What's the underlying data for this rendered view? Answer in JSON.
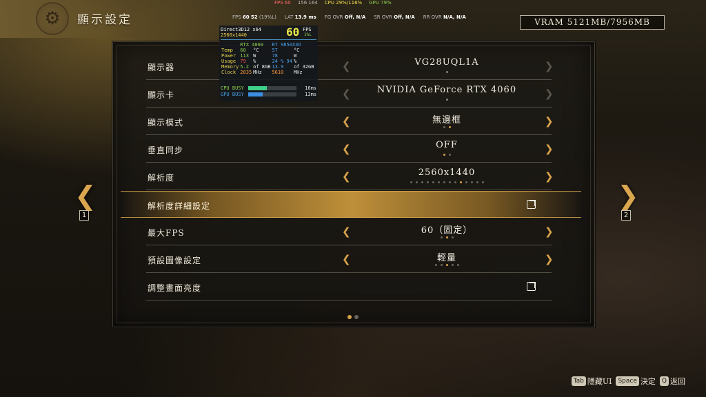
{
  "header": {
    "title": "顯示設定",
    "vram": "VRAM 5121MB/7956MB"
  },
  "top_strip": {
    "fps": "FPS 60",
    "fps_range": "156 164",
    "cpu": "CPU 29%/116%",
    "gpu": "GPU 79%"
  },
  "stats": {
    "fps_label": "FPS",
    "fps_value": "60",
    "fps_low": "52",
    "fps_low_pct": "(19%L)",
    "lat_label": "LAT",
    "lat_value": "13.9 ms",
    "fg_label": "FG OVR",
    "fg_value": "Off,  N/A",
    "sr_label": "SR OVR",
    "sr_value": "Off,  N/A",
    "rr_label": "RR OVR",
    "rr_value": "N/A,  N/A"
  },
  "osd": {
    "api": "Direct3D12 x64",
    "resolution": "2560x1440",
    "fps": "60",
    "fps_label": "FPS",
    "fps_sub": "1%L",
    "gpu_name": "RTX 4060",
    "cpu_name": "R7 9850X3D",
    "rows": [
      {
        "label": "Temp",
        "gpu": "60",
        "gpu_unit": "°C",
        "cpu": "57",
        "cpu_unit": "°C"
      },
      {
        "label": "Power",
        "gpu": "113",
        "gpu_unit": "W",
        "cpu": "78",
        "cpu_unit": "W"
      },
      {
        "label": "Usage",
        "gpu": "79",
        "gpu_unit": "%",
        "cpu": "24 % 94",
        "cpu_unit": "%"
      },
      {
        "label": "Memory",
        "gpu": "5.2",
        "gpu_unit": "of 8GB",
        "cpu": "13.9",
        "cpu_unit": "of 32GB"
      },
      {
        "label": "Clock",
        "gpu": "2835",
        "gpu_unit": "MHz",
        "cpu": "5610",
        "cpu_unit": "MHz"
      }
    ],
    "cpu_busy_label": "CPU BUSY",
    "cpu_busy_ms": "16ms",
    "cpu_busy_fraction": 0.38,
    "gpu_busy_label": "GPU BUSY",
    "gpu_busy_ms": "13ms",
    "gpu_busy_fraction": 0.3
  },
  "settings": [
    {
      "label": "顯示器",
      "value": "VG28UQL1A"
    },
    {
      "label": "顯示卡",
      "value": "NVIDIA GeForce RTX 4060"
    },
    {
      "label": "顯示模式",
      "value": "無邊框",
      "dots_total": 2,
      "dots_selected": 2
    },
    {
      "label": "垂直同步",
      "value": "OFF",
      "dots_total": 2,
      "dots_selected": 1
    },
    {
      "label": "解析度",
      "value": "2560x1440",
      "dots_total": 14,
      "dots_selected": 10
    },
    {
      "label": "解析度詳細設定"
    },
    {
      "label": "最大FPS",
      "value": "60（固定）",
      "dots_total": 3,
      "dots_selected": 2
    },
    {
      "label": "預設圖像設定",
      "value": "輕量",
      "dots_total": 5,
      "dots_selected": 3
    },
    {
      "label": "調整畫面亮度"
    }
  ],
  "nav": {
    "left_page": "1",
    "right_page": "2",
    "page_count": 2,
    "current_page": 1
  },
  "hints": [
    {
      "key": "Tab",
      "label": "隱藏UI"
    },
    {
      "key": "Space",
      "label": "決定"
    },
    {
      "key": "Q",
      "label": "返回"
    }
  ],
  "colors": {
    "accent": "#d7a24a",
    "highlight": "#c8963c"
  }
}
